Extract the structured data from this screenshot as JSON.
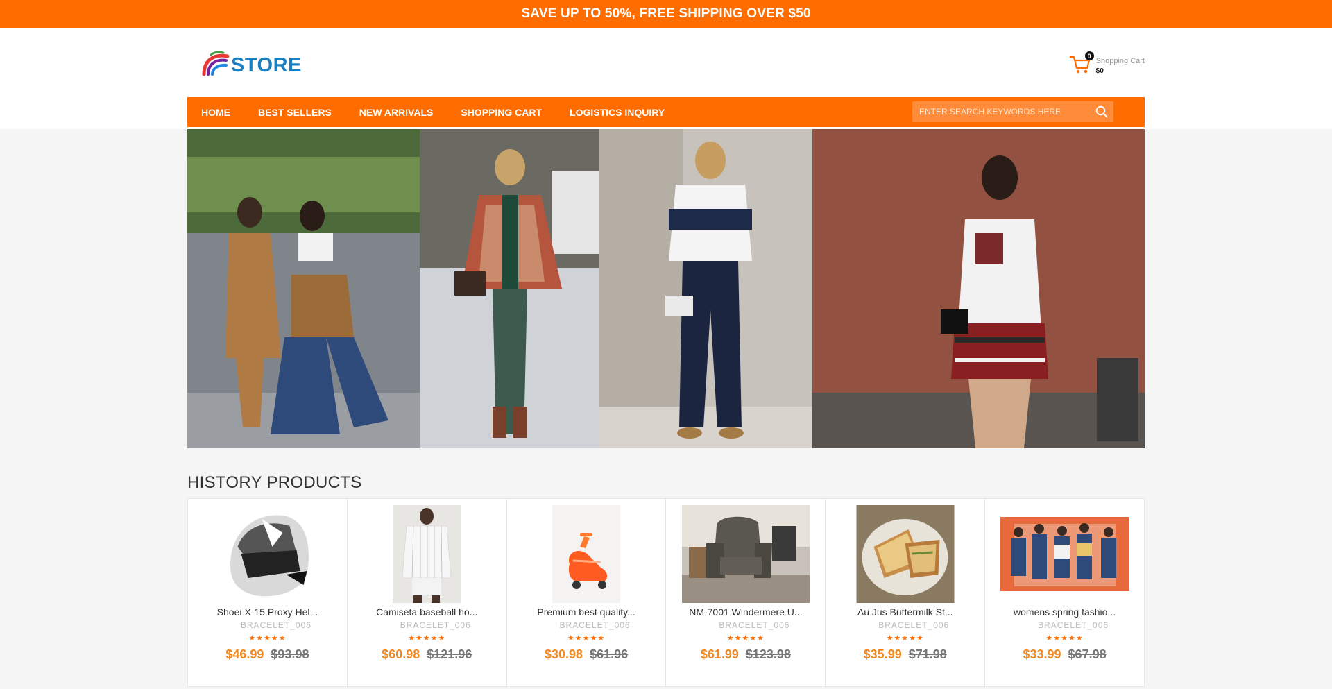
{
  "promo": "SAVE UP TO 50%, FREE SHIPPING OVER $50",
  "logo": {
    "text": "STORE"
  },
  "cart": {
    "count": "0",
    "label": "Shopping Cart",
    "total": "$0"
  },
  "nav": [
    "HOME",
    "BEST SELLERS",
    "NEW ARRIVALS",
    "SHOPPING CART",
    "LOGISTICS INQUIRY"
  ],
  "search": {
    "placeholder": "ENTER SEARCH KEYWORDS HERE"
  },
  "section_title": "HISTORY PRODUCTS",
  "products": [
    {
      "name": "Shoei X-15 Proxy Hel...",
      "brand": "BRACELET_006",
      "stars": "★★★★★",
      "price": "$46.99",
      "old_price": "$93.98"
    },
    {
      "name": "Camiseta baseball ho...",
      "brand": "BRACELET_006",
      "stars": "★★★★★",
      "price": "$60.98",
      "old_price": "$121.96"
    },
    {
      "name": "Premium best quality...",
      "brand": "BRACELET_006",
      "stars": "★★★★★",
      "price": "$30.98",
      "old_price": "$61.96"
    },
    {
      "name": "NM-7001 Windermere U...",
      "brand": "BRACELET_006",
      "stars": "★★★★★",
      "price": "$61.99",
      "old_price": "$123.98"
    },
    {
      "name": "Au Jus Buttermilk St...",
      "brand": "BRACELET_006",
      "stars": "★★★★★",
      "price": "$35.99",
      "old_price": "$71.98"
    },
    {
      "name": "womens spring fashio...",
      "brand": "BRACELET_006",
      "stars": "★★★★★",
      "price": "$33.99",
      "old_price": "$67.98"
    }
  ],
  "colors": {
    "accent": "#ff6d00",
    "price": "#f08a24",
    "logo": "#1a7fc1"
  }
}
